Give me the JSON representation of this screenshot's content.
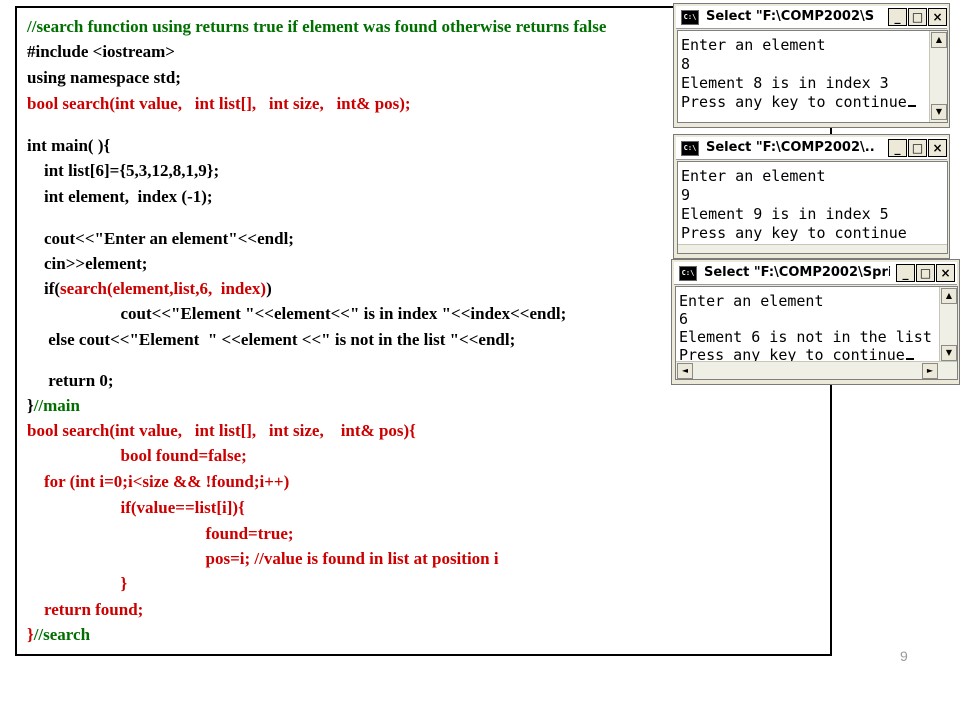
{
  "code": {
    "lines": [
      {
        "segments": [
          {
            "text": "//search function using returns true if element was found otherwise returns false",
            "color": "green"
          }
        ]
      },
      {
        "segments": [
          {
            "text": "#include <iostream>",
            "color": "black"
          }
        ]
      },
      {
        "segments": [
          {
            "text": "using namespace std;",
            "color": "black"
          }
        ]
      },
      {
        "segments": [
          {
            "text": "bool search(int value,   int list[],   int size,   int& pos);",
            "color": "red"
          }
        ]
      },
      {
        "segments": [
          {
            "text": "int main( ){",
            "color": "black"
          }
        ]
      },
      {
        "segments": [
          {
            "text": "    int list[6]={5,3,12,8,1,9};",
            "color": "black"
          }
        ]
      },
      {
        "segments": [
          {
            "text": "    int element,  index (-1);",
            "color": "black"
          }
        ]
      },
      {
        "segments": [
          {
            "text": "    cout<<\"Enter an element\"<<endl;",
            "color": "black"
          }
        ]
      },
      {
        "segments": [
          {
            "text": "    cin>>element;",
            "color": "black"
          }
        ]
      },
      {
        "segments": [
          {
            "text": "    if(",
            "color": "black"
          },
          {
            "text": "search(element,list,6,  index)",
            "color": "red"
          },
          {
            "text": ")",
            "color": "black"
          }
        ]
      },
      {
        "segments": [
          {
            "text": "                      cout<<\"Element \"<<element<<\" is in index \"<<index<<endl;",
            "color": "black"
          }
        ]
      },
      {
        "segments": [
          {
            "text": "     else cout<<\"Element  \" <<element <<\" is not in the list \"<<endl;",
            "color": "black"
          }
        ]
      },
      {
        "segments": [
          {
            "text": "     return 0;",
            "color": "black"
          }
        ]
      },
      {
        "segments": [
          {
            "text": "}",
            "color": "black"
          },
          {
            "text": "//main",
            "color": "green"
          }
        ]
      },
      {
        "segments": [
          {
            "text": "bool search(int value,   int list[],   int size,    int& pos){",
            "color": "red"
          }
        ]
      },
      {
        "segments": [
          {
            "text": "                      bool found=false;",
            "color": "red"
          }
        ]
      },
      {
        "segments": [
          {
            "text": "    for (int i=0;i<size && !found;i++)",
            "color": "red"
          }
        ]
      },
      {
        "segments": [
          {
            "text": "                      if(value==list[i]){",
            "color": "red"
          }
        ]
      },
      {
        "segments": [
          {
            "text": "                                          found=true;",
            "color": "red"
          }
        ]
      },
      {
        "segments": [
          {
            "text": "                                          pos=i; //value is found in list at position i",
            "color": "red"
          }
        ]
      },
      {
        "segments": [
          {
            "text": "                      }",
            "color": "red"
          }
        ]
      },
      {
        "segments": [
          {
            "text": "    return found;",
            "color": "red"
          }
        ]
      },
      {
        "segments": [
          {
            "text": "}",
            "color": "red"
          },
          {
            "text": "//search",
            "color": "green"
          }
        ]
      }
    ]
  },
  "consoles": [
    {
      "title": "Select \"F:\\COMP2002\\S...",
      "icon_label": "C:\\",
      "lines": [
        "Enter an element",
        "8",
        "Element 8 is in index 3",
        "Press any key to continue"
      ],
      "buttons": {
        "minimize": "_",
        "maximize": "□",
        "close": "×"
      }
    },
    {
      "title": "Select \"F:\\COMP2002\\...",
      "icon_label": "C:\\",
      "lines": [
        "Enter an element",
        "9",
        "Element 9 is in index 5",
        "Press any key to continue"
      ],
      "buttons": {
        "minimize": "_",
        "maximize": "□",
        "close": "×"
      }
    },
    {
      "title": "Select \"F:\\COMP2002\\Spri...",
      "icon_label": "C:\\",
      "lines": [
        "Enter an element",
        "6",
        "Element 6 is not in the list",
        "Press any key to continue"
      ],
      "buttons": {
        "minimize": "_",
        "maximize": "□",
        "close": "×"
      }
    }
  ],
  "scroll_glyphs": {
    "up": "▲",
    "down": "▼",
    "left": "◄",
    "right": "►"
  },
  "page_number": "9"
}
